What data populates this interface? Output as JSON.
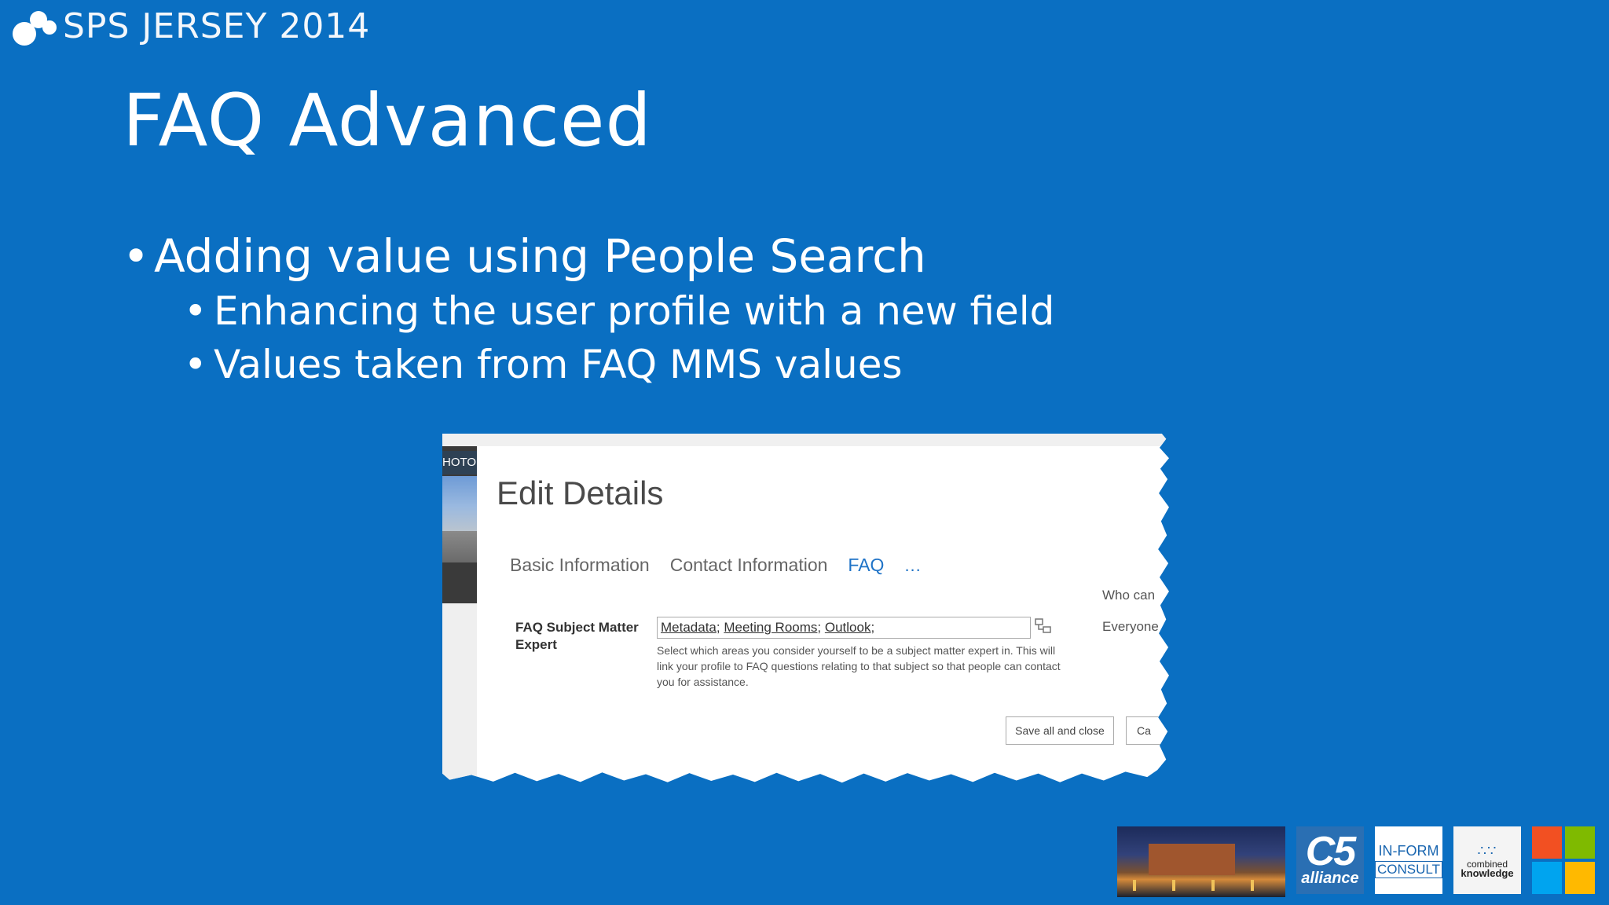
{
  "event": {
    "name": "SPS JERSEY 2014"
  },
  "slide": {
    "title": "FAQ Advanced",
    "bullets": [
      {
        "text": "Adding value using People Search",
        "level": 1
      },
      {
        "text": "Enhancing the user profile with a new field",
        "level": 2
      },
      {
        "text": "Values taken from FAQ MMS values",
        "level": 2
      }
    ]
  },
  "screenshot": {
    "photo_label": "HOTO",
    "heading": "Edit Details",
    "tabs": [
      {
        "label": "Basic Information",
        "active": false
      },
      {
        "label": "Contact Information",
        "active": false
      },
      {
        "label": "FAQ",
        "active": true
      }
    ],
    "more_tabs": "...",
    "who_can": "Who can",
    "visibility": "Everyone",
    "field": {
      "label": "FAQ Subject Matter Expert",
      "values": [
        "Metadata",
        "Meeting Rooms",
        "Outlook"
      ],
      "help": "Select which areas you consider yourself to be a subject matter expert in. This will link your profile to FAQ questions relating to that subject so that people can contact you for assistance."
    },
    "buttons": {
      "save": "Save all and close",
      "cancel": "Ca"
    }
  },
  "sponsors": {
    "c5_big": "C5",
    "c5_small": "alliance",
    "inform_top": "IN-FORM",
    "inform_bottom": "CONSULT",
    "combined_top": "combined",
    "combined_bottom": "knowledge"
  },
  "colors": {
    "background": "#0a6fc2",
    "tab_active": "#1f73c7",
    "ms_red": "#f25022",
    "ms_green": "#7fba00",
    "ms_blue": "#00a4ef",
    "ms_yellow": "#ffb900"
  }
}
